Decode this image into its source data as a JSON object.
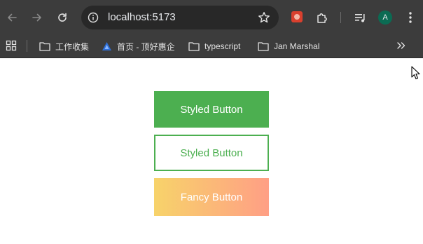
{
  "browser": {
    "address_bar": {
      "url": "localhost:5173"
    },
    "profile": {
      "initial": "A",
      "color": "#0b6b53"
    },
    "bookmarks": [
      {
        "label": "工作收集",
        "icon": "folder-icon"
      },
      {
        "label": "首页 - 顶好惠企",
        "icon": "site-favicon-icon"
      },
      {
        "label": "typescript",
        "icon": "folder-icon"
      },
      {
        "label": "Jan Marshal",
        "icon": "folder-icon"
      }
    ],
    "toolbar_colors": {
      "chrome_bg": "#3c3c3c",
      "omnibox_bg": "#282828"
    }
  },
  "page": {
    "buttons": {
      "styled_solid": {
        "label": "Styled Button",
        "bg": "#4caf50",
        "text_color": "#ffffff"
      },
      "styled_outline": {
        "label": "Styled Button",
        "border_color": "#4caf50",
        "text_color": "#4caf50"
      },
      "fancy": {
        "label": "Fancy Button",
        "gradient": [
          "#f7d36a",
          "#ff9f85"
        ],
        "text_color": "#ffffff"
      }
    }
  }
}
